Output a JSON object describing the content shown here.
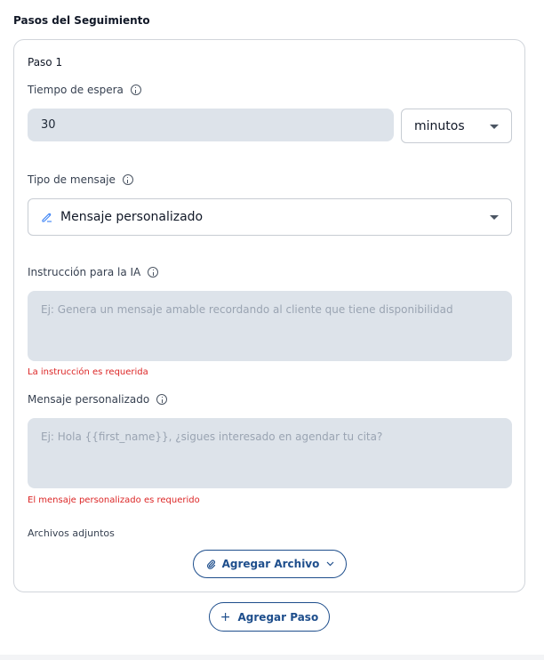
{
  "section_title": "Pasos del Seguimiento",
  "step": {
    "title": "Paso 1",
    "wait_time": {
      "label": "Tiempo de espera",
      "value": "30",
      "unit_selected": "minutos"
    },
    "message_type": {
      "label": "Tipo de mensaje",
      "selected": "Mensaje personalizado"
    },
    "ai_instruction": {
      "label": "Instrucción para la IA",
      "placeholder": "Ej: Genera un mensaje amable recordando al cliente que tiene disponibilidad",
      "error": "La instrucción es requerida"
    },
    "custom_message": {
      "label": "Mensaje personalizado",
      "placeholder": "Ej: Hola {{first_name}}, ¿sigues interesado en agendar tu cita?",
      "error": "El mensaje personalizado es requerido"
    },
    "attachments": {
      "label": "Archivos adjuntos",
      "add_button": "Agregar Archivo"
    }
  },
  "add_step_button": "Agregar Paso",
  "colors": {
    "accent": "#1e4e8c",
    "error": "#dc2626",
    "input_fill": "#dde3ea"
  }
}
